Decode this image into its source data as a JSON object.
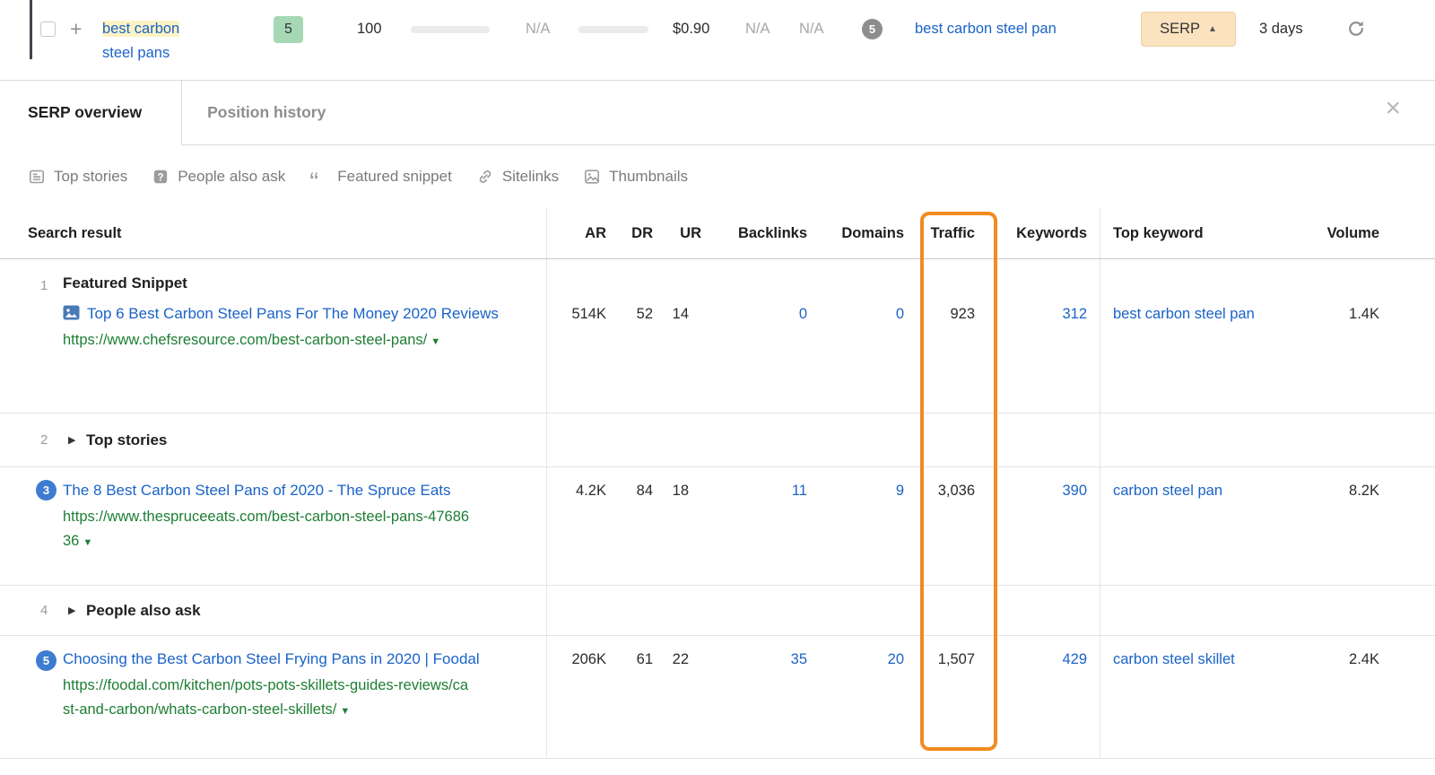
{
  "icons": {
    "plus": "+",
    "close": "×",
    "caret_up": "▲",
    "caret_down": "▼",
    "expand": "▶",
    "quote": "“"
  },
  "colors": {
    "accent_orange": "#F28B1F",
    "link_blue": "#1A63C8",
    "url_green": "#1E7E34",
    "badge_green_bg": "#A6D8B6",
    "highlight_yellow": "#FCF3C5",
    "serp_button_bg": "#FBE3BF"
  },
  "keyword_row": {
    "keyword_highlight": "best carbon",
    "keyword_rest": "steel pans",
    "position_badge": "5",
    "kd": "100",
    "volume_na": "N/A",
    "cpc": "$0.90",
    "traffic_na": "N/A",
    "value_na": "N/A",
    "serp_features_count": "5",
    "top_keyword": "best carbon steel pan",
    "serp_button": "SERP",
    "updated": "3 days"
  },
  "panel": {
    "tabs": [
      {
        "label": "SERP overview"
      },
      {
        "label": "Position history"
      }
    ],
    "chips": [
      {
        "label": "Top stories"
      },
      {
        "label": "People also ask"
      },
      {
        "label": "Featured snippet"
      },
      {
        "label": "Sitelinks"
      },
      {
        "label": "Thumbnails"
      }
    ],
    "table": {
      "columns": [
        "Search result",
        "AR",
        "DR",
        "UR",
        "Backlinks",
        "Domains",
        "Traffic",
        "Keywords",
        "Top keyword",
        "Volume"
      ],
      "rows": [
        {
          "num": "1",
          "heading": "Featured Snippet",
          "title": "Top 6 Best Carbon Steel Pans For The Money 2020 Reviews",
          "url": "https://www.chefsresource.com/best-carbon-steel-pans/",
          "ar": "514K",
          "dr": "52",
          "ur": "14",
          "backlinks": "0",
          "domains": "0",
          "traffic": "923",
          "keywords": "312",
          "top_keyword": "best carbon steel pan",
          "volume": "1.4K"
        },
        {
          "num": "2",
          "label": "Top stories"
        },
        {
          "num": "3",
          "title": "The 8 Best Carbon Steel Pans of 2020 - The Spruce Eats",
          "url": "https://www.thespruceeats.com/best-carbon-steel-pans-4768636",
          "ar": "4.2K",
          "dr": "84",
          "ur": "18",
          "backlinks": "11",
          "domains": "9",
          "traffic": "3,036",
          "keywords": "390",
          "top_keyword": "carbon steel pan",
          "volume": "8.2K"
        },
        {
          "num": "4",
          "label": "People also ask"
        },
        {
          "num": "5",
          "title": "Choosing the Best Carbon Steel Frying Pans in 2020 | Foodal",
          "url": "https://foodal.com/kitchen/pots-pots-skillets-guides-reviews/cast-and-carbon/whats-carbon-steel-skillets/",
          "ar": "206K",
          "dr": "61",
          "ur": "22",
          "backlinks": "35",
          "domains": "20",
          "traffic": "1,507",
          "keywords": "429",
          "top_keyword": "carbon steel skillet",
          "volume": "2.4K"
        }
      ]
    }
  }
}
